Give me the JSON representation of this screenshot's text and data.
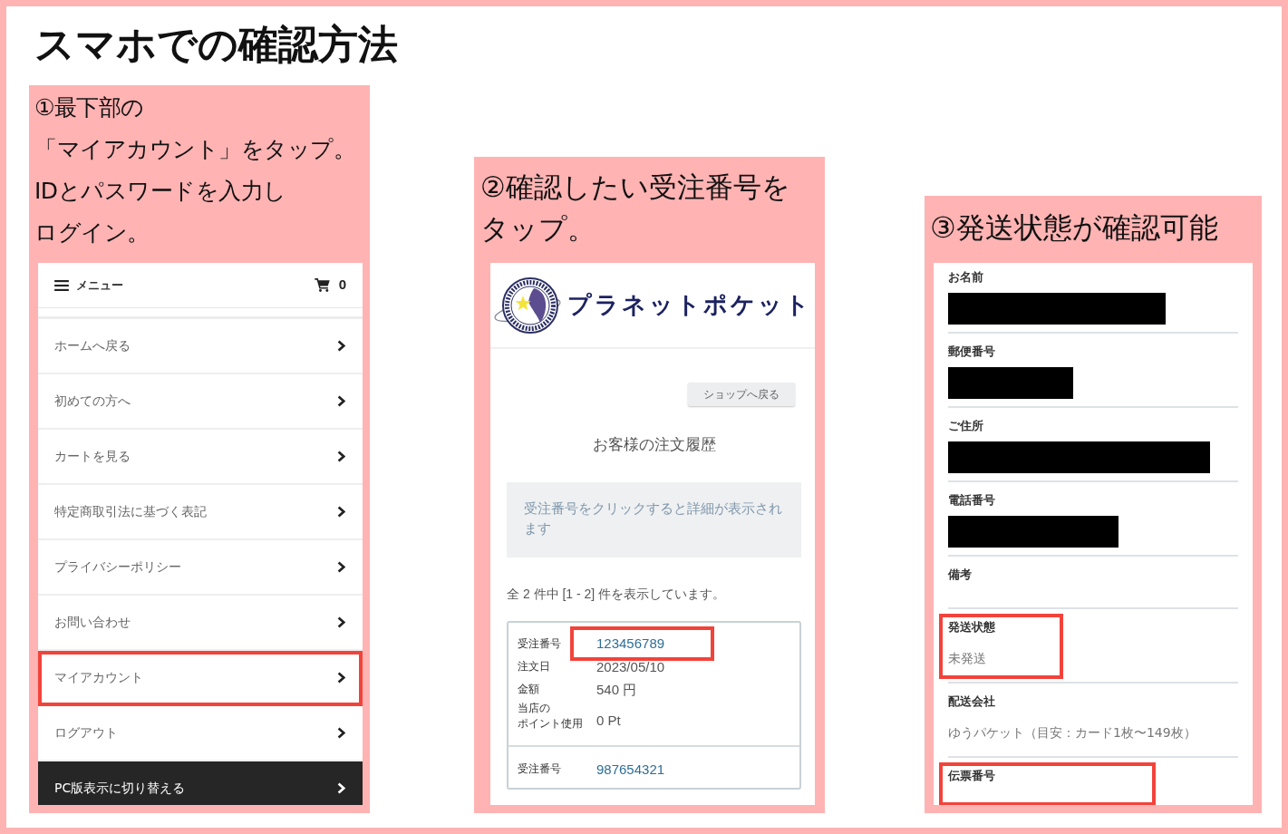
{
  "title": "スマホでの確認方法",
  "panels": [
    {
      "kind": "menu",
      "caption": [
        "①最下部の",
        "「マイアカウント」をタップ。",
        "IDとパスワードを入力し",
        "ログイン。"
      ],
      "screen": {
        "menu_label": "メニュー",
        "cart_count": "0",
        "items": [
          {
            "label": "ホームへ戻る",
            "highlighted": false
          },
          {
            "label": "初めての方へ",
            "highlighted": false
          },
          {
            "label": "カートを見る",
            "highlighted": false
          },
          {
            "label": "特定商取引法に基づく表記",
            "highlighted": false
          },
          {
            "label": "プライバシーポリシー",
            "highlighted": false
          },
          {
            "label": "お問い合わせ",
            "highlighted": false
          },
          {
            "label": "マイアカウント",
            "highlighted": true
          },
          {
            "label": "ログアウト",
            "highlighted": false
          }
        ],
        "footer_button": "PC版表示に切り替える"
      }
    },
    {
      "kind": "orders",
      "caption": [
        "②確認したい受注番号を",
        "タップ。"
      ],
      "screen": {
        "brand": "プラネットポケット",
        "back_button": "ショップへ戻る",
        "heading": "お客様の注文履歴",
        "notice": "受注番号をクリックすると詳細が表示されます",
        "count_text": "全 2 件中 [1 - 2] 件を表示しています。",
        "orders": [
          {
            "rows": [
              {
                "label": [
                  "受注番号"
                ],
                "value": "123456789",
                "kind": "link",
                "highlighted": true
              },
              {
                "label": [
                  "注文日"
                ],
                "value": "2023/05/10",
                "kind": "text",
                "highlighted": false
              },
              {
                "label": [
                  "金額"
                ],
                "value": "540 円",
                "kind": "text",
                "highlighted": false
              },
              {
                "label": [
                  "当店の",
                  "ポイント使用"
                ],
                "value": "0 Pt",
                "kind": "text",
                "highlighted": false
              }
            ]
          },
          {
            "rows": [
              {
                "label": [
                  "受注番号"
                ],
                "value": "987654321",
                "kind": "link",
                "highlighted": false
              }
            ]
          }
        ]
      }
    },
    {
      "kind": "details",
      "caption": [
        "③発送状態が確認可能"
      ],
      "screen": {
        "fields": [
          {
            "label": "お名前",
            "redacted": true,
            "highlighted": false
          },
          {
            "label": "郵便番号",
            "redacted": true,
            "highlighted": false
          },
          {
            "label": "ご住所",
            "redacted": true,
            "highlighted": false
          },
          {
            "label": "電話番号",
            "redacted": true,
            "highlighted": false
          },
          {
            "label": "備考",
            "redacted": false,
            "highlighted": false
          },
          {
            "label": "発送状態",
            "value": "未発送",
            "redacted": false,
            "highlighted": true
          },
          {
            "label": "配送会社",
            "value": "ゆうパケット（目安：カード1枚〜149枚）",
            "redacted": false,
            "highlighted": false
          },
          {
            "label": "伝票番号",
            "redacted": false,
            "highlighted": true
          }
        ]
      }
    }
  ]
}
